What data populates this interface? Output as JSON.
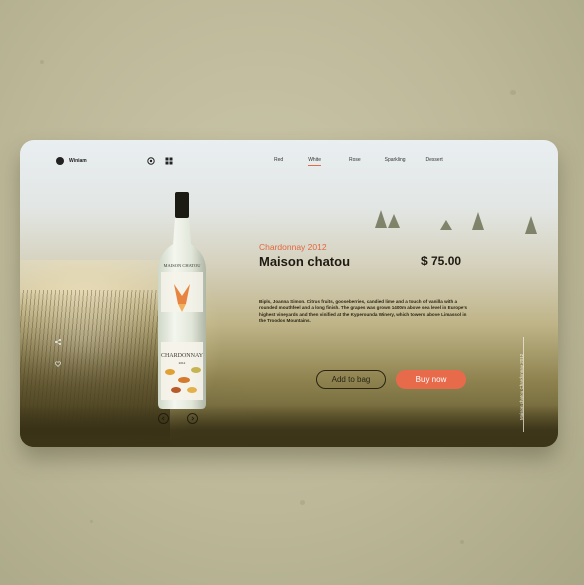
{
  "brand": {
    "name": "Winiam"
  },
  "nav": {
    "menu": [
      "Red",
      "White",
      "Rose",
      "Sparkling",
      "Dessert"
    ],
    "active": "White"
  },
  "product": {
    "subtitle": "Chardonnay 2012",
    "name": "Maison chatou",
    "price": "$ 75.00",
    "description": "Bipls, Joanna Simon. Citrus fruits, gooseberries, candied lime and a touch of vanilla with a rounded mouthfeel and a long finish. The grapes was grown 1400m above sea level in Europe's highest vineyards and then vinified at the Kyperounda Winery, which towers above Limassol in the Troodos Mountains.",
    "vertical_label": "Maison chatou Chardonnay 2012",
    "label_top": "MAISON CHATOU",
    "label_bottom": "CHARDONNAY",
    "label_small": "2012"
  },
  "actions": {
    "add_to_bag": "Add to bag",
    "buy_now": "Buy now"
  },
  "colors": {
    "accent": "#e76a4b",
    "text_dark": "#1f1a12",
    "background": "#bcb898"
  },
  "icons": [
    "wine-icon",
    "grid-icon",
    "share-icon",
    "heart-icon",
    "arrow-left-icon",
    "arrow-right-icon"
  ]
}
